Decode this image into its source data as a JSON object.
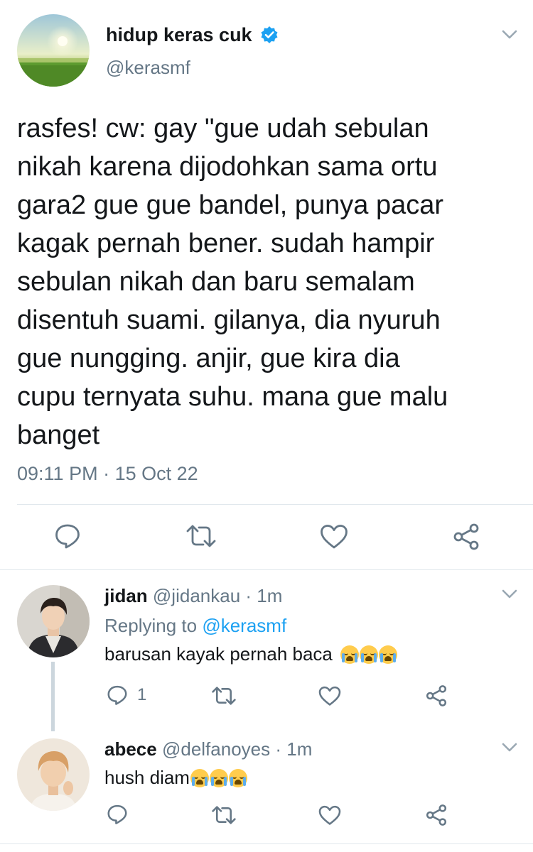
{
  "tweet": {
    "display_name": "hidup keras cuk",
    "handle": "@kerasmf",
    "verified": true,
    "text_lines": [
      "rasfes! cw: gay \"gue udah sebulan",
      "nikah karena dijodohkan sama ortu",
      "gara2 gue gue bandel, punya pacar",
      "kagak pernah bener. sudah hampir",
      "sebulan nikah dan baru semalam",
      "disentuh suami. gilanya, dia nyuruh",
      "gue nungging. anjir, gue kira dia",
      "cupu ternyata suhu. mana gue malu",
      "banget"
    ],
    "time": "09:11 PM",
    "separator": "·",
    "date": "15 Oct 22"
  },
  "actions": {
    "reply_icon": "reply-icon",
    "retweet_icon": "retweet-icon",
    "like_icon": "heart-icon",
    "share_icon": "share-icon"
  },
  "replies": [
    {
      "display_name": "jidan",
      "handle": "@jidankau",
      "separator": "·",
      "time": "1m",
      "replying_prefix": "Replying to",
      "replying_to": "@kerasmf",
      "text": "barusan kayak pernah baca",
      "emoji_count": 3,
      "emoji_name": "loudly-crying-face",
      "reply_count": "1"
    },
    {
      "display_name": "abece",
      "handle": "@delfanoyes",
      "separator": "·",
      "time": "1m",
      "text": "hush diam",
      "emoji_count": 3,
      "emoji_name": "loudly-crying-face",
      "reply_count": ""
    }
  ],
  "colors": {
    "text": "#14171a",
    "muted": "#657786",
    "link": "#1da1f2",
    "verified": "#1da1f2",
    "divider": "#e1e8ed"
  }
}
